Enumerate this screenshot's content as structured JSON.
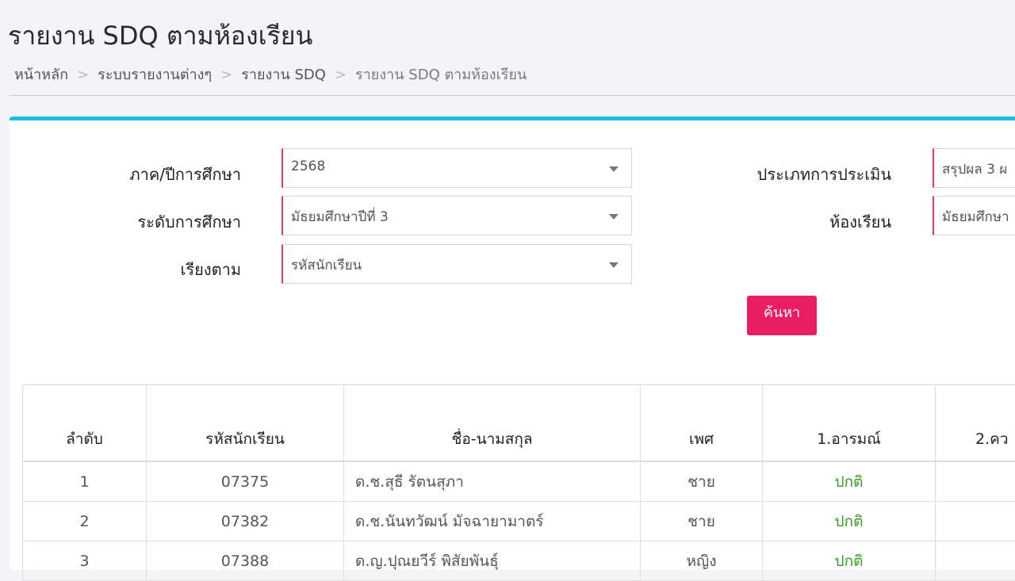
{
  "header": {
    "title": "รายงาน SDQ ตามห้องเรียน",
    "breadcrumb": [
      "หน้าหลัก",
      "ระบบรายงานต่างๆ",
      "รายงาน SDQ",
      "รายงาน SDQ ตามห้องเรียน"
    ],
    "separator": ">"
  },
  "form": {
    "term_label": "ภาค/ปีการศึกษา",
    "term_value": "2568",
    "level_label": "ระดับการศึกษา",
    "level_value": "มัธยมศึกษาปีที่ 3",
    "sort_label": "เรียงตาม",
    "sort_value": "รหัสนักเรียน",
    "eval_type_label": "ประเภทการประเมิน",
    "eval_type_value": "สรุปผล 3 ผ",
    "classroom_label": "ห้องเรียน",
    "classroom_value": "มัธยมศึกษา",
    "search_label": "ค้นหา"
  },
  "table": {
    "headers": [
      "ลำดับ",
      "รหัสนักเรียน",
      "ชื่อ-นามสกุล",
      "เพศ",
      "1.อารมณ์",
      "2.คว"
    ],
    "rows": [
      {
        "no": "1",
        "id": "07375",
        "name": "ด.ช.สุธี รัตนสุภา",
        "gender": "ชาย",
        "emotion": "ปกติ",
        "col2": ""
      },
      {
        "no": "2",
        "id": "07382",
        "name": "ด.ช.นันทวัฒน์ มัจฉายามาตร์",
        "gender": "ชาย",
        "emotion": "ปกติ",
        "col2": ""
      },
      {
        "no": "3",
        "id": "07388",
        "name": "ด.ญ.ปุณยวีร์ พิสัยพันธุ์",
        "gender": "หญิง",
        "emotion": "ปกติ",
        "col2": ""
      }
    ]
  },
  "colors": {
    "accent_top_border": "#1dbde6",
    "required_marker": "#e6357a",
    "search_button": "#e91e63",
    "status_normal": "#3a9d23"
  }
}
